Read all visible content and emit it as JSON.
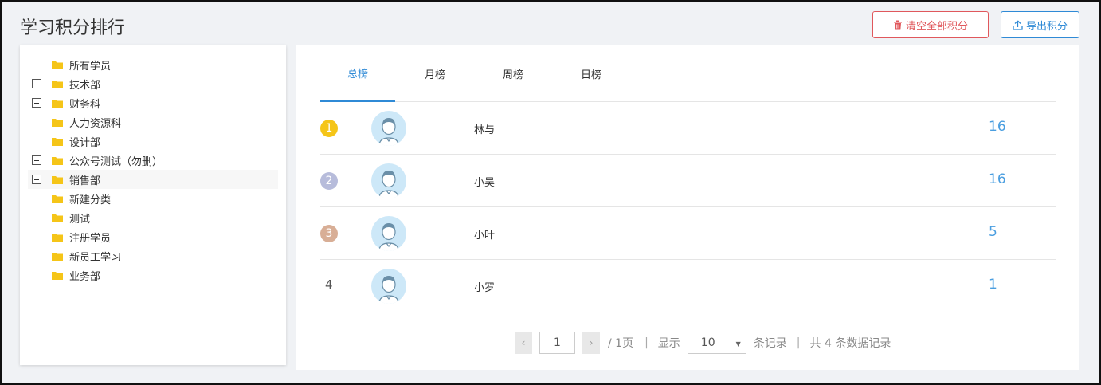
{
  "header": {
    "title": "学习积分排行",
    "clear_label": "清空全部积分",
    "export_label": "导出积分"
  },
  "tree": {
    "items": [
      {
        "label": "所有学员",
        "expandable": false
      },
      {
        "label": "技术部",
        "expandable": true
      },
      {
        "label": "财务科",
        "expandable": true
      },
      {
        "label": "人力资源科",
        "expandable": false
      },
      {
        "label": "设计部",
        "expandable": false
      },
      {
        "label": "公众号测试（勿删）",
        "expandable": true
      },
      {
        "label": "销售部",
        "expandable": true
      },
      {
        "label": "新建分类",
        "expandable": false
      },
      {
        "label": "测试",
        "expandable": false
      },
      {
        "label": "注册学员",
        "expandable": false
      },
      {
        "label": "新员工学习",
        "expandable": false
      },
      {
        "label": "业务部",
        "expandable": false
      }
    ],
    "folder_color": "#f5c518"
  },
  "tabs": {
    "items": [
      "总榜",
      "月榜",
      "周榜",
      "日榜"
    ],
    "active": 0
  },
  "ranking": {
    "rows": [
      {
        "rank": "1",
        "name": "林与",
        "score": "16"
      },
      {
        "rank": "2",
        "name": "小吴",
        "score": "16"
      },
      {
        "rank": "3",
        "name": "小叶",
        "score": "5"
      },
      {
        "rank": "4",
        "name": "小罗",
        "score": "1"
      }
    ],
    "badge_colors": [
      "#f5c518",
      "#b7bcdb",
      "#d8ae96"
    ]
  },
  "pager": {
    "prev": "‹",
    "next": "›",
    "current_page": "1",
    "total_pages": "/ 1页",
    "show_label": "显示",
    "page_size": "10",
    "records_label": "条记录",
    "total_label": "共 4 条数据记录"
  },
  "colors": {
    "accent": "#2f8ad6",
    "danger": "#e0585c",
    "score": "#4a9ee0"
  }
}
